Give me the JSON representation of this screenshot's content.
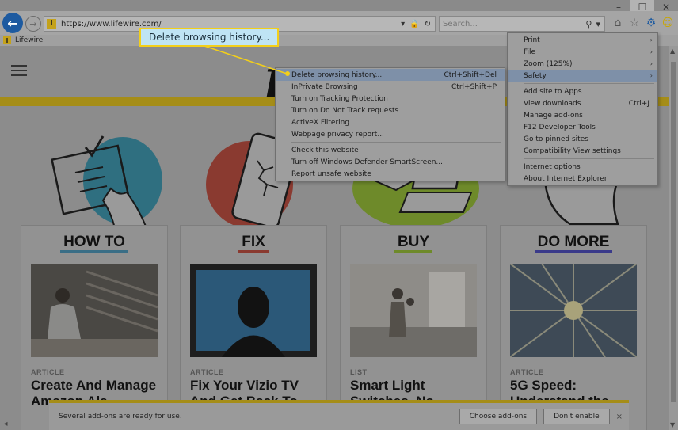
{
  "browser": {
    "url": "https://www.lifewire.com/",
    "search_placeholder": "Search...",
    "tab_title": "Lifewire",
    "favicon_letter": "l"
  },
  "page": {
    "logo": "L",
    "categories": [
      {
        "title": "HOW TO",
        "tag": "ARTICLE",
        "headline": "Create And Manage Amazon Ala"
      },
      {
        "title": "FIX",
        "tag": "ARTICLE",
        "headline": "Fix Your Vizio TV And Get Back To"
      },
      {
        "title": "BUY",
        "tag": "LIST",
        "headline": "Smart Light Switches, No"
      },
      {
        "title": "DO MORE",
        "tag": "ARTICLE",
        "headline": "5G Speed: Understand the"
      }
    ]
  },
  "notification": {
    "text": "Several add-ons are ready for use.",
    "choose_label": "Choose add-ons",
    "dont_enable_label": "Don't enable",
    "close": "×"
  },
  "callout": {
    "text": "Delete browsing history..."
  },
  "tools_menu": {
    "items": [
      {
        "label": "Print",
        "submenu": true
      },
      {
        "label": "File",
        "submenu": true
      },
      {
        "label": "Zoom (125%)",
        "submenu": true
      },
      {
        "label": "Safety",
        "submenu": true,
        "highlight": true
      },
      {
        "label": "Add site to Apps"
      },
      {
        "label": "View downloads",
        "shortcut": "Ctrl+J"
      },
      {
        "label": "Manage add-ons"
      },
      {
        "label": "F12 Developer Tools"
      },
      {
        "label": "Go to pinned sites"
      },
      {
        "label": "Compatibility View settings"
      },
      {
        "label": "Internet options"
      },
      {
        "label": "About Internet Explorer"
      }
    ]
  },
  "safety_menu": {
    "items": [
      {
        "label": "Delete browsing history...",
        "shortcut": "Ctrl+Shift+Del",
        "highlight": true
      },
      {
        "label": "InPrivate Browsing",
        "shortcut": "Ctrl+Shift+P"
      },
      {
        "label": "Turn on Tracking Protection"
      },
      {
        "label": "Turn on Do Not Track requests"
      },
      {
        "label": "ActiveX Filtering"
      },
      {
        "label": "Webpage privacy report..."
      },
      {
        "label": "Check this website"
      },
      {
        "label": "Turn off Windows Defender SmartScreen..."
      },
      {
        "label": "Report unsafe website"
      }
    ]
  },
  "colors": {
    "accent_yellow": "#f3cf1a",
    "callout_bg": "#bfe4f4",
    "ie_blue": "#1d5aa0"
  }
}
